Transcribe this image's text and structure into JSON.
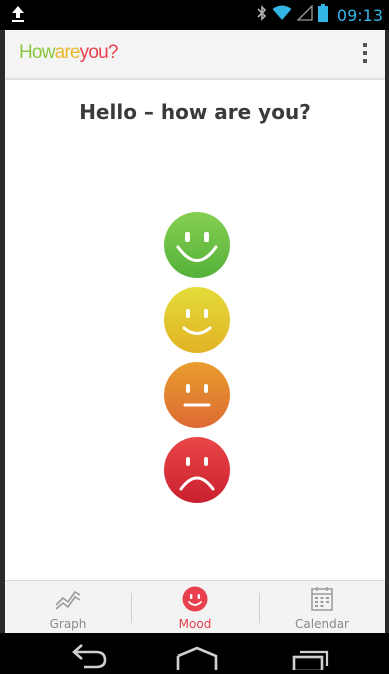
{
  "status_bar": {
    "time": "09:13",
    "icons": [
      "upload-icon",
      "bluetooth-icon",
      "wifi-icon",
      "signal-icon",
      "battery-icon"
    ],
    "accent": "#33b5e5"
  },
  "action_bar": {
    "title_parts": [
      {
        "text": "How",
        "color": "#8cc63f"
      },
      {
        "text": "are",
        "color": "#e8b92c"
      },
      {
        "text": "you?",
        "color": "#e94050"
      }
    ],
    "overflow_icon": "overflow-menu-icon"
  },
  "main": {
    "greeting": "Hello – how are you?",
    "moods": [
      {
        "name": "very-happy",
        "icon": "big-smile-face-icon",
        "color": "#6cc045"
      },
      {
        "name": "happy",
        "icon": "smile-face-icon",
        "color": "#e4c82e"
      },
      {
        "name": "neutral",
        "icon": "neutral-face-icon",
        "color": "#e18330"
      },
      {
        "name": "sad",
        "icon": "sad-face-icon",
        "color": "#dc3340"
      }
    ]
  },
  "tabs": [
    {
      "label": "Graph",
      "icon": "graph-icon",
      "selected": false
    },
    {
      "label": "Mood",
      "icon": "smiley-icon",
      "selected": true
    },
    {
      "label": "Calendar",
      "icon": "calendar-icon",
      "selected": false
    }
  ],
  "nav_bar": {
    "buttons": [
      "back-icon",
      "home-icon",
      "recent-apps-icon"
    ]
  },
  "colors": {
    "selected_tab": "#e94050",
    "tab_text": "#8a8a8a"
  }
}
